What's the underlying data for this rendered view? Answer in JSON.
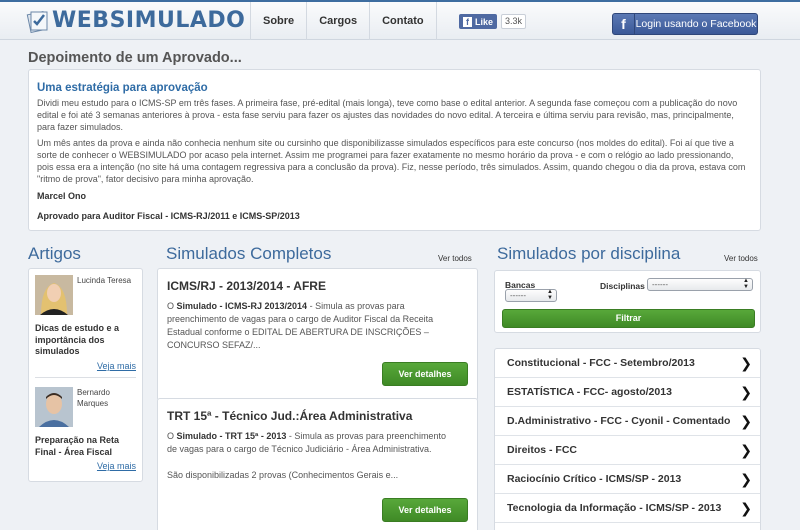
{
  "header": {
    "logo_text": "WEBSIMULADO",
    "nav": [
      "Sobre",
      "Cargos",
      "Contato"
    ],
    "fb_like_label": "Like",
    "fb_like_count": "3.3k",
    "fb_login_label": "Login usando o Facebook"
  },
  "testimonial": {
    "section_title": "Depoimento de um Aprovado...",
    "heading": "Uma estratégia para aprovação",
    "paragraph1": "Dividi meu estudo para o ICMS-SP em três fases. A primeira fase, pré-edital (mais longa), teve como base o edital anterior. A segunda fase começou com a publicação do novo edital e foi até 3 semanas anteriores à prova - esta fase serviu para fazer os ajustes das novidades do novo edital. A terceira e última serviu para revisão, mas, principalmente, para fazer simulados.",
    "paragraph2": "Um mês antes da prova e ainda não conhecia nenhum site ou cursinho que disponibilizasse simulados específicos para este concurso (nos moldes do edital). Foi aí que tive a sorte de conhecer o WEBSIMULADO por acaso pela internet. Assim me programei para fazer exatamente no mesmo horário da prova - e com o relógio ao lado pressionando, pois essa era a intenção (no site há uma contagem regressiva para a conclusão da prova). Fiz, nesse período, três simulados. Assim, quando chegou o dia da prova, estava com \"ritmo de prova\", fator decisivo para minha aprovação.",
    "author": "Marcel Ono",
    "role": "Aprovado para Auditor Fiscal - ICMS-RJ/2011 e ICMS-SP/2013"
  },
  "artigos": {
    "title": "Artigos",
    "items": [
      {
        "name": "Lucinda Teresa",
        "title": "Dicas de estudo e a importância dos simulados",
        "more": "Veja mais"
      },
      {
        "name": "Bernardo Marques",
        "title": "Preparação na Reta Final - Área Fiscal",
        "more": "Veja mais"
      }
    ]
  },
  "simulados": {
    "title": "Simulados Completos",
    "ver_todos": "Ver todos",
    "items": [
      {
        "title": "ICMS/RJ - 2013/2014 - AFRE",
        "prefix": "O ",
        "bold": "Simulado - ICMS-RJ 2013/2014",
        "desc": " - Simula as provas para preenchimento de vagas para o cargo de Auditor Fiscal da Receita Estadual conforme o EDITAL DE ABERTURA DE INSCRIÇÕES – CONCURSO SEFAZ/...",
        "extra": "",
        "button": "Ver detalhes"
      },
      {
        "title": "TRT 15ª - Técnico Jud.:Área Administrativa",
        "prefix": "O ",
        "bold": "Simulado - TRT 15ª - 2013",
        "desc": " - Simula as provas para preenchimento de vagas para o cargo de Técnico Judiciário - Área Administrativa.",
        "extra": "São disponibilizadas 2 provas (Conhecimentos Gerais e...",
        "button": "Ver detalhes"
      }
    ]
  },
  "disciplinas": {
    "title": "Simulados por disciplina",
    "ver_todos": "Ver todos",
    "bancas_label": "Bancas",
    "bancas_value": "------",
    "disciplinas_label": "Disciplinas",
    "disciplinas_value": "------",
    "filter_button": "Filtrar",
    "items": [
      "Constitucional - FCC - Setembro/2013",
      "ESTATÍSTICA - FCC- agosto/2013",
      "D.Administrativo - FCC - Cyonil - Comentado",
      "Direitos - FCC",
      "Raciocínio Crítico - ICMS/SP - 2013",
      "Tecnologia da Informação - ICMS/SP - 2013"
    ]
  },
  "colors": {
    "brand_blue": "#3d6a9c",
    "link_blue": "#2f6ca6",
    "green": "#4a9a2f",
    "facebook": "#3b5998"
  }
}
